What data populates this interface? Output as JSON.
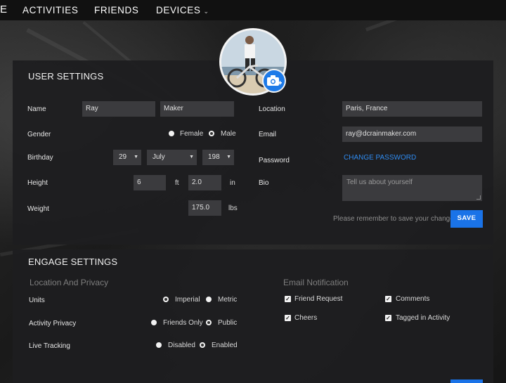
{
  "nav": {
    "brand_stub": "E",
    "items": [
      {
        "label": "ACTIVITIES"
      },
      {
        "label": "FRIENDS"
      },
      {
        "label": "DEVICES"
      }
    ]
  },
  "user_settings": {
    "title": "USER SETTINGS",
    "name_label": "Name",
    "first_name": "Ray",
    "last_name": "Maker",
    "gender_label": "Gender",
    "gender_options": [
      {
        "label": "Female",
        "checked": false
      },
      {
        "label": "Male",
        "checked": true
      }
    ],
    "birthday_label": "Birthday",
    "birthday_day": "29",
    "birthday_month": "July",
    "birthday_year": "198",
    "height_label": "Height",
    "height_ft": "6",
    "height_ft_unit": "ft",
    "height_in": "2.0",
    "height_in_unit": "in",
    "weight_label": "Weight",
    "weight_value": "175.0",
    "weight_unit": "lbs",
    "location_label": "Location",
    "location_value": "Paris, France",
    "email_label": "Email",
    "email_value": "ray@dcrainmaker.com",
    "password_label": "Password",
    "change_password": "CHANGE PASSWORD",
    "bio_label": "Bio",
    "bio_placeholder": "Tell us about yourself",
    "save_hint": "Please remember to save your changes",
    "save_label": "SAVE"
  },
  "engage_settings": {
    "title": "ENGAGE SETTINGS",
    "location_privacy_heading": "Location And Privacy",
    "units_label": "Units",
    "units_options": [
      {
        "label": "Imperial",
        "checked": true
      },
      {
        "label": "Metric",
        "checked": false
      }
    ],
    "activity_privacy_label": "Activity Privacy",
    "activity_privacy_options": [
      {
        "label": "Friends Only",
        "checked": false
      },
      {
        "label": "Public",
        "checked": true
      }
    ],
    "live_tracking_label": "Live Tracking",
    "live_tracking_options": [
      {
        "label": "Disabled",
        "checked": false
      },
      {
        "label": "Enabled",
        "checked": true
      }
    ],
    "email_notification_heading": "Email Notification",
    "notifications": [
      {
        "label": "Friend Request",
        "checked": true
      },
      {
        "label": "Comments",
        "checked": true
      },
      {
        "label": "Cheers",
        "checked": true
      },
      {
        "label": "Tagged in Activity",
        "checked": true
      }
    ]
  },
  "colors": {
    "accent": "#1a73e8",
    "link": "#2f8bf0",
    "panel": "#1e1e20",
    "input": "#3b3b3e"
  },
  "icons": {
    "camera": "camera-add-icon",
    "dropdown": "chevron-down-icon"
  }
}
